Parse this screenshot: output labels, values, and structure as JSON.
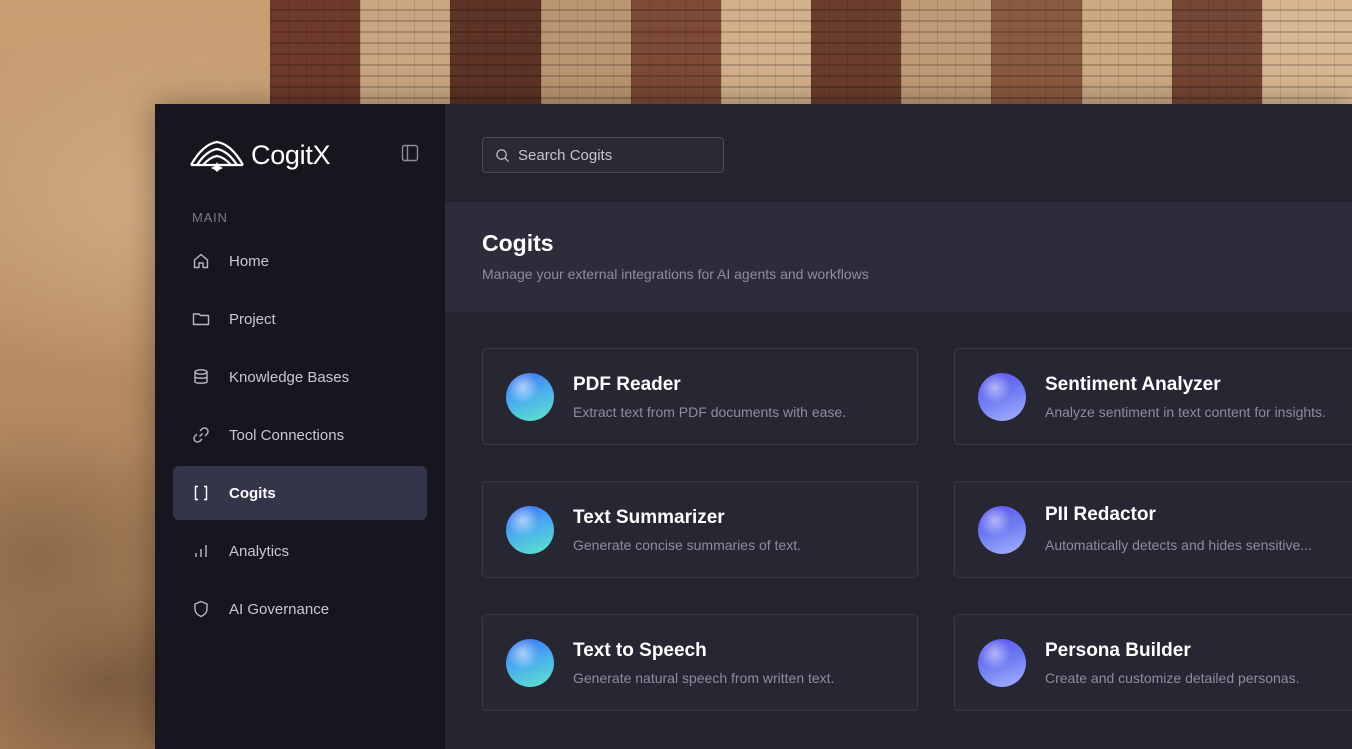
{
  "brand": {
    "name": "CogitX"
  },
  "sidebar": {
    "section_label": "MAIN",
    "items": [
      {
        "label": "Home",
        "icon": "home-icon",
        "active": false
      },
      {
        "label": "Project",
        "icon": "folder-icon",
        "active": false
      },
      {
        "label": "Knowledge Bases",
        "icon": "database-icon",
        "active": false
      },
      {
        "label": "Tool Connections",
        "icon": "link-icon",
        "active": false
      },
      {
        "label": "Cogits",
        "icon": "brackets-icon",
        "active": true
      },
      {
        "label": "Analytics",
        "icon": "bar-chart-icon",
        "active": false
      },
      {
        "label": "AI Governance",
        "icon": "shield-icon",
        "active": false
      }
    ]
  },
  "search": {
    "placeholder": "Search Cogits",
    "value": ""
  },
  "page": {
    "title": "Cogits",
    "subtitle": "Manage your external integrations for AI agents and workflows"
  },
  "cogits": [
    {
      "title": "PDF Reader",
      "description": "Extract text from PDF documents with ease.",
      "orb": "teal"
    },
    {
      "title": "Sentiment Analyzer",
      "description": "Analyze sentiment in text content for insights.",
      "orb": "violet"
    },
    {
      "title": "Text Summarizer",
      "description": "Generate concise summaries of text.",
      "orb": "teal"
    },
    {
      "title": "PII Redactor",
      "description": "Automatically detects and hides sensitive...",
      "orb": "violet"
    },
    {
      "title": "Text to Speech",
      "description": "Generate natural speech from written text.",
      "orb": "teal"
    },
    {
      "title": "Persona Builder",
      "description": "Create and customize detailed personas.",
      "orb": "violet"
    }
  ],
  "colors": {
    "sidebar_bg": "#17161f",
    "main_bg": "#24232e",
    "header_band_bg": "#2d2c3b",
    "active_item_bg": "#34344a",
    "card_border": "#3a3948"
  }
}
